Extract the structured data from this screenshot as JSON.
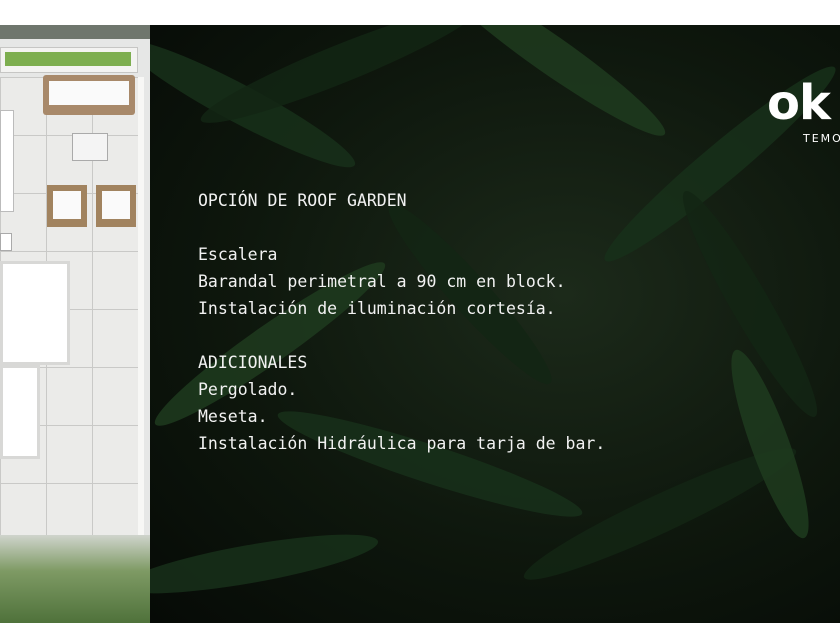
{
  "logo": {
    "text": "ok",
    "subtitle": "TEMO"
  },
  "sections": [
    {
      "heading": "OPCIÓN DE ROOF GARDEN"
    },
    {
      "items": [
        "Escalera",
        "Barandal perimetral a 90 cm en block.",
        "Instalación de iluminación cortesía."
      ]
    },
    {
      "heading": "ADICIONALES",
      "items": [
        "Pergolado.",
        "Meseta.",
        "Instalación Hidráulica para tarja de bar."
      ]
    }
  ],
  "colors": {
    "panel_bg": "#0e170d",
    "text": "#f2f2f2",
    "leaf": "#18301a"
  }
}
